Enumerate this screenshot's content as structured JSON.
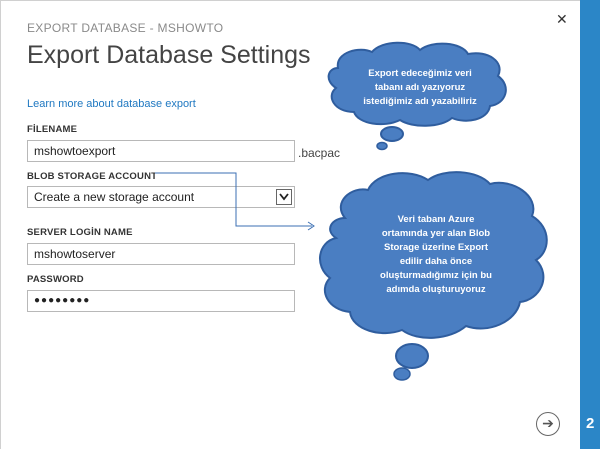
{
  "dialog": {
    "subtitle": "EXPORT DATABASE - MSHOWTO",
    "title": "Export Database Settings",
    "learn_link": "Learn more about database export",
    "close_glyph": "✕"
  },
  "form": {
    "filename_label": "FİLENAME",
    "filename_value": "mshowtoexport",
    "filename_suffix": ".bacpac",
    "blob_label": "BLOB STORAGE ACCOUNT",
    "blob_value": "Create a new storage account",
    "server_label": "SERVER LOGİN NAME",
    "server_value": "mshowtoserver",
    "password_label": "PASSWORD",
    "password_value": "●●●●●●●●"
  },
  "callouts": {
    "top": [
      "Export edeceğimiz veri",
      "tabanı adı yazıyoruz",
      "istediğimiz adı yazabiliriz"
    ],
    "bottom": [
      "Veri tabanı Azure",
      "ortamında yer alan Blob",
      "Storage üzerine Export",
      "edilir daha önce",
      "oluşturmadığımız için bu",
      "adımda oluşturuyoruz"
    ]
  },
  "nav": {
    "next_icon": "➔",
    "step_number": "2"
  },
  "colors": {
    "accent": "#2b86c7",
    "callout_fill": "#4a7ec2",
    "callout_stroke": "#2f5d9e"
  }
}
